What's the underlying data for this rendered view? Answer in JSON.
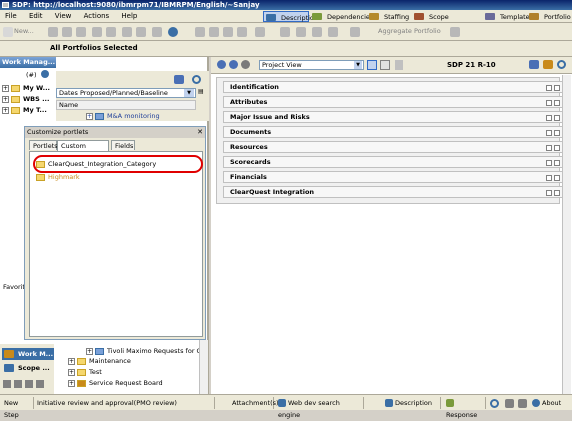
{
  "window": {
    "title": "SDP: http://localhost:9080/ibmrpm71/IBMRPM/English/~Sanjay"
  },
  "menu": [
    "File",
    "Edit",
    "View",
    "Actions",
    "Help"
  ],
  "tabs": [
    {
      "label": "Description",
      "icon": "description-icon",
      "color": "#3a6ea5",
      "active": true
    },
    {
      "label": "Dependencies",
      "icon": "dependencies-icon",
      "color": "#7a9a3a",
      "active": false
    },
    {
      "label": "Staffing",
      "icon": "staffing-icon",
      "color": "#b58a2a",
      "active": false
    },
    {
      "label": "Scope Management",
      "icon": "scope-icon",
      "color": "#a05030",
      "active": false
    },
    {
      "label": "Template",
      "icon": "template-icon",
      "color": "#6a6a9a",
      "active": false
    },
    {
      "label": "Portfolio",
      "icon": "portfolio-icon",
      "color": "#b0802a",
      "active": false
    }
  ],
  "toolbar": {
    "new_label": "New...",
    "aggregate_label": "Aggregate Portfolio"
  },
  "portfolio_bar": {
    "title": "All Portfolios Selected"
  },
  "left": {
    "header": "Work Manag...",
    "tree_top": [
      {
        "label": "My W..."
      },
      {
        "label": "WBS ..."
      },
      {
        "label": "My T..."
      }
    ],
    "dates_select": "Dates Proposed/Planned/Baseline",
    "column_name": "Name",
    "monitoring_item": "M&A monitoring",
    "favorites_label": "Favorit",
    "tree_bottom": [
      {
        "label": "Tivoli Maximo Requests for C..."
      },
      {
        "label": "Maintenance"
      },
      {
        "label": "Test"
      },
      {
        "label": "Service Request Board"
      }
    ]
  },
  "bottom_nav": [
    {
      "label": "Work M...",
      "color": "#c98a1a"
    },
    {
      "label": "Scope ...",
      "color": "#3a6ea5"
    }
  ],
  "dialog": {
    "title": "Customize portlets",
    "tabs": [
      {
        "label": "Portlets",
        "selected": false
      },
      {
        "label": "Custom Portlets",
        "selected": true
      },
      {
        "label": "Fields",
        "selected": false
      }
    ],
    "items": [
      {
        "label": "ClearQuest_Integration_Category"
      },
      {
        "label": "Highmark"
      }
    ]
  },
  "right": {
    "view_select": "Project View",
    "project_label": "SDP 21 R-10",
    "portlets": [
      "Identification",
      "Attributes",
      "Major Issue and Risks",
      "Documents",
      "Resources",
      "Scorecards",
      "Financials",
      "ClearQuest Integration"
    ]
  },
  "statusbar": {
    "new_step": "New Step",
    "step_text": "Initiative review and approval(PMO review)",
    "attachments": "Attachment(s)",
    "search_engine": "Web dev search engine",
    "description": "Description",
    "response": "Response",
    "about": "About"
  }
}
